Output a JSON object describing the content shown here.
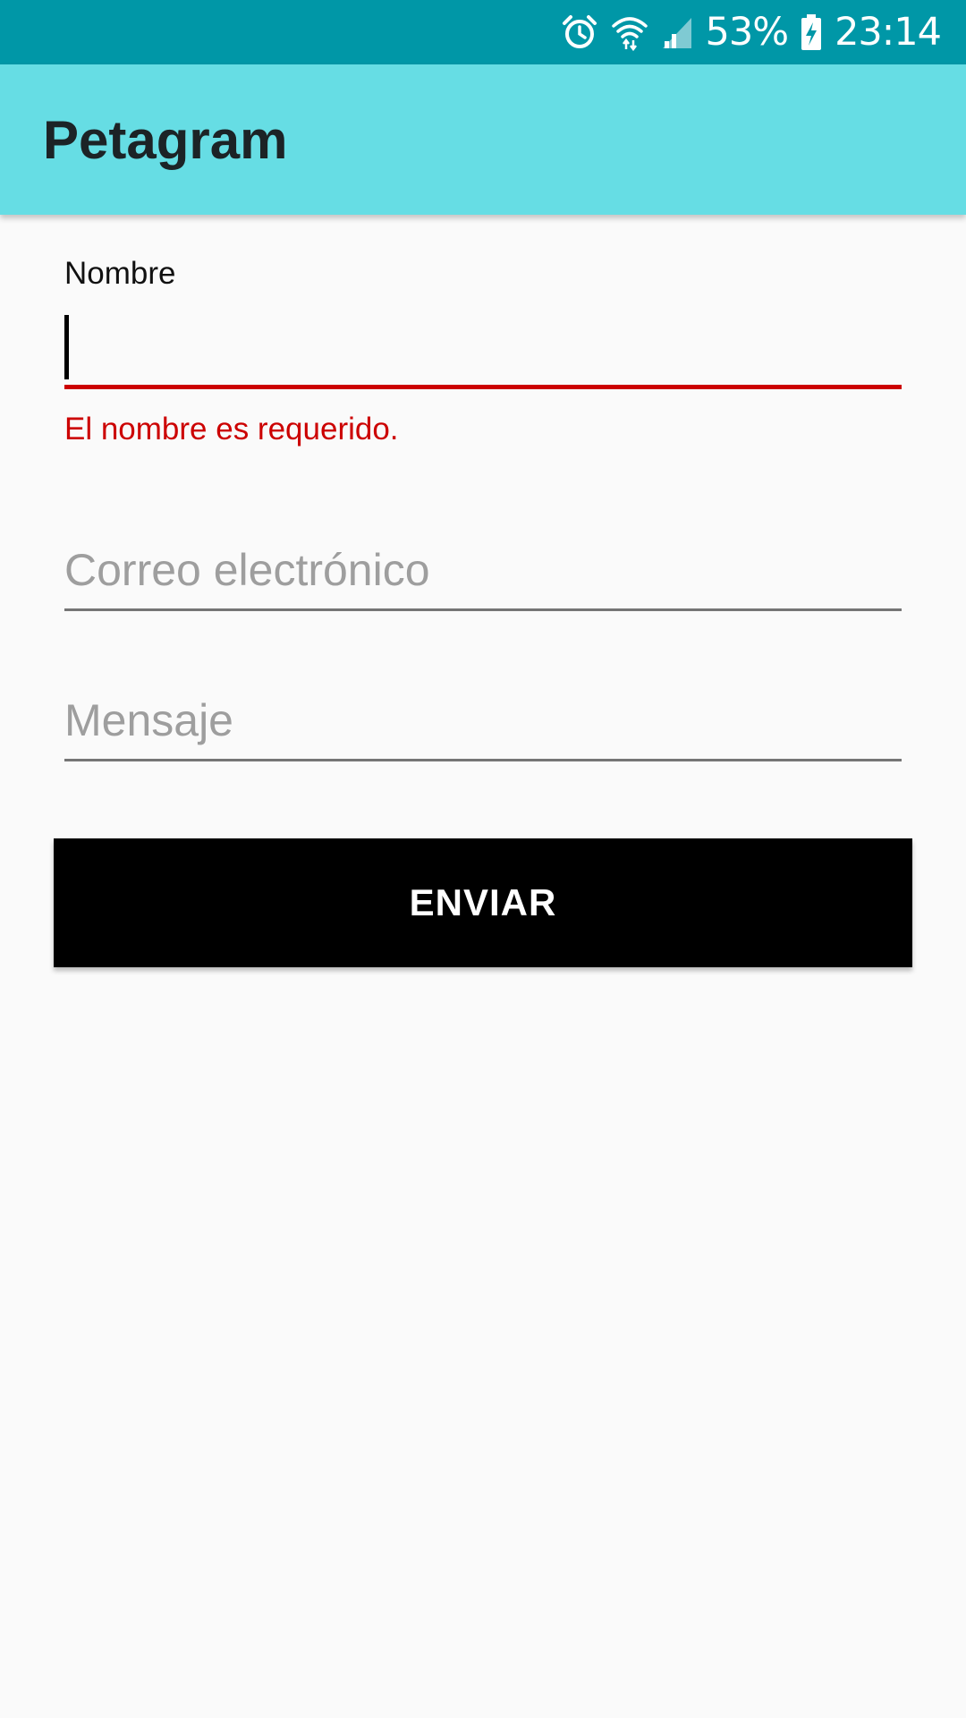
{
  "status_bar": {
    "battery_percent": "53%",
    "time": "23:14",
    "icons": [
      "alarm-icon",
      "wifi-icon",
      "signal-icon",
      "battery-charging-icon"
    ],
    "color": "#0097a7"
  },
  "app_bar": {
    "title": "Petagram",
    "color": "#66dde4"
  },
  "form": {
    "nombre": {
      "label": "Nombre",
      "value": "",
      "error": "El nombre es requerido.",
      "error_color": "#cc0000"
    },
    "correo": {
      "placeholder": "Correo electrónico",
      "value": ""
    },
    "mensaje": {
      "placeholder": "Mensaje",
      "value": ""
    },
    "submit_label": "ENVIAR"
  }
}
